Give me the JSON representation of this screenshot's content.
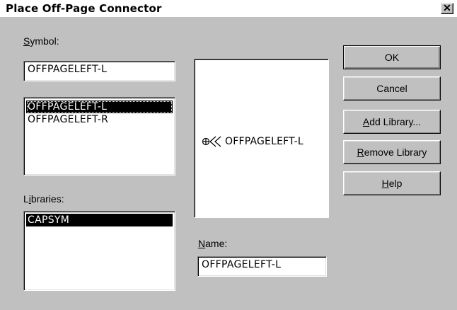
{
  "window": {
    "title": "Place Off-Page Connector",
    "close_glyph": "✕"
  },
  "symbol": {
    "label_mn": "S",
    "label_rest": "ymbol:",
    "value": "OFFPAGELEFT-L",
    "list": [
      "OFFPAGELEFT-L",
      "OFFPAGELEFT-R"
    ],
    "selected_index": 0
  },
  "libraries": {
    "label_pre": "L",
    "label_mn": "i",
    "label_rest": "braries:",
    "list": [
      "CAPSYM"
    ],
    "selected_index": 0
  },
  "preview": {
    "icon": "offpage-connector-left-icon",
    "text": "OFFPAGELEFT-L"
  },
  "name": {
    "label_mn": "N",
    "label_rest": "ame:",
    "value": "OFFPAGELEFT-L"
  },
  "buttons": {
    "ok": "OK",
    "cancel": "Cancel",
    "add_library_mn": "A",
    "add_library_rest": "dd Library...",
    "remove_library_mn": "R",
    "remove_library_rest": "emove Library",
    "help_mn": "H",
    "help_rest": "elp"
  }
}
